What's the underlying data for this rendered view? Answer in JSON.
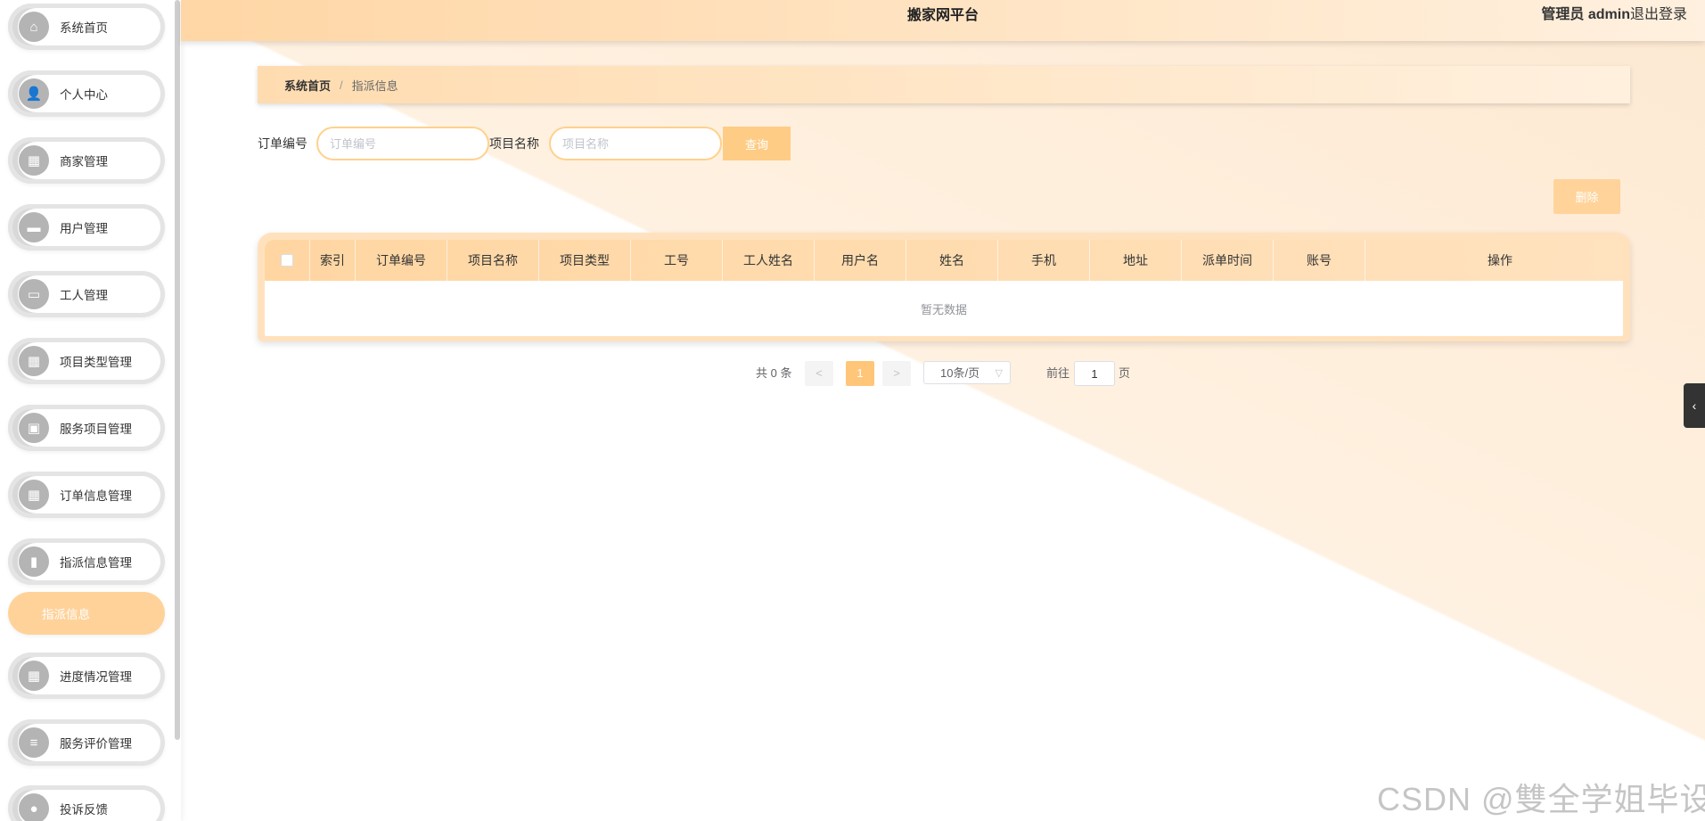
{
  "header": {
    "title": "搬家网平台",
    "user": "管理员 admin",
    "logout": "退出登录"
  },
  "sidebar": {
    "items": [
      {
        "label": "系统首页",
        "icon": "home-icon",
        "glyph": "⌂"
      },
      {
        "label": "个人中心",
        "icon": "user-icon",
        "glyph": "👤"
      },
      {
        "label": "商家管理",
        "icon": "grid-icon",
        "glyph": "▦"
      },
      {
        "label": "用户管理",
        "icon": "briefcase-icon",
        "glyph": "▬"
      },
      {
        "label": "工人管理",
        "icon": "monitor-icon",
        "glyph": "▭"
      },
      {
        "label": "项目类型管理",
        "icon": "grid-icon",
        "glyph": "▦"
      },
      {
        "label": "服务项目管理",
        "icon": "clipboard-icon",
        "glyph": "▣"
      },
      {
        "label": "订单信息管理",
        "icon": "grid-icon",
        "glyph": "▦"
      },
      {
        "label": "指派信息管理",
        "icon": "bar-chart-icon",
        "glyph": "▮"
      },
      {
        "label": "指派信息",
        "active": true
      },
      {
        "label": "进度情况管理",
        "icon": "grid-icon",
        "glyph": "▦"
      },
      {
        "label": "服务评价管理",
        "icon": "list-icon",
        "glyph": "≡"
      },
      {
        "label": "投诉反馈",
        "icon": "bulb-icon",
        "glyph": "●"
      }
    ]
  },
  "breadcrumb": {
    "home": "系统首页",
    "separator": "/",
    "current": "指派信息"
  },
  "search": {
    "order_no_label": "订单编号",
    "order_no_placeholder": "订单编号",
    "project_name_label": "项目名称",
    "project_name_placeholder": "项目名称",
    "query_button": "查询"
  },
  "toolbar": {
    "delete_button": "删除"
  },
  "table": {
    "columns": [
      "索引",
      "订单编号",
      "项目名称",
      "项目类型",
      "工号",
      "工人姓名",
      "用户名",
      "姓名",
      "手机",
      "地址",
      "派单时间",
      "账号",
      "操作"
    ],
    "empty_text": "暂无数据"
  },
  "pagination": {
    "total": "共 0 条",
    "prev": "<",
    "current_page": "1",
    "next": ">",
    "page_size": "10条/页",
    "goto_label": "前往",
    "goto_value": "1",
    "page_label": "页"
  },
  "side_tab": {
    "glyph": "‹"
  },
  "watermark": "CSDN @雙全学姐毕设",
  "colors": {
    "accent": "#ffcc85",
    "header_start": "#ffd6a5",
    "sidebar_icon": "#b4b4b4"
  }
}
